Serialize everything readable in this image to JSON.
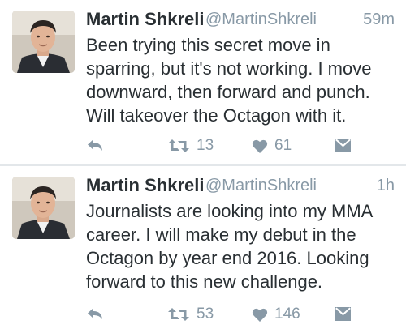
{
  "tweets": [
    {
      "name": "Martin Shkreli",
      "handle": "@MartinShkreli",
      "time": "59m",
      "lines": [
        "Been trying this secret move in",
        "sparring, but it's not working. I move",
        "downward, then forward and punch.",
        "Will takeover the Octagon with it."
      ],
      "retweets": "13",
      "likes": "61"
    },
    {
      "name": "Martin Shkreli",
      "handle": "@MartinShkreli",
      "time": "1h",
      "lines": [
        "Journalists are looking into my MMA",
        "career. I will make my debut in the",
        "Octagon by year end 2016. Looking",
        "forward to this new challenge."
      ],
      "retweets": "53",
      "likes": "146"
    }
  ],
  "colors": {
    "text": "#292f33",
    "muted": "#8899a6",
    "divider": "#e3e7ea"
  },
  "icons": {
    "reply": "reply-arrow-icon",
    "retweet": "retweet-icon",
    "like": "heart-icon",
    "dm": "envelope-icon"
  }
}
